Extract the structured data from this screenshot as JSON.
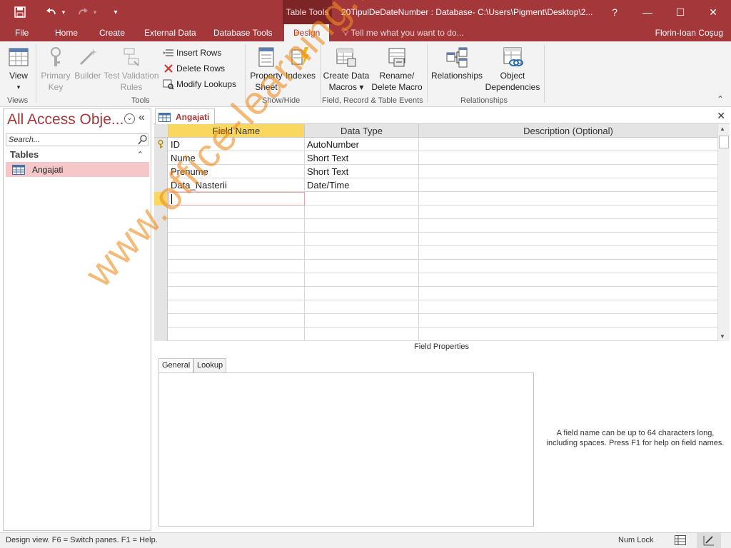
{
  "window": {
    "title": "20TipulDeDateNumber : Database- C:\\Users\\Pigment\\Desktop\\2...",
    "context_tab_group": "Table Tools",
    "help": "?",
    "minimize": "—",
    "maximize": "☐",
    "close": "✕"
  },
  "qat": {
    "save": "🖫",
    "undo": "↶",
    "undo_dd": "▾",
    "redo": "↷",
    "redo_dd": "▾",
    "customize": "▾"
  },
  "tabs": [
    {
      "label": "File"
    },
    {
      "label": "Home"
    },
    {
      "label": "Create"
    },
    {
      "label": "External Data"
    },
    {
      "label": "Database Tools"
    },
    {
      "label": "Design"
    }
  ],
  "tellme": "Tell me what you want to do...",
  "user": "Florin-Ioan Coşug",
  "ribbon": {
    "view": {
      "line1": "View",
      "line2": "▾",
      "group": "Views"
    },
    "primary_key": {
      "line1": "Primary",
      "line2": "Key"
    },
    "builder": {
      "line1": "Builder"
    },
    "test_validation": {
      "line1": "Test Validation",
      "line2": "Rules"
    },
    "insert_rows": "Insert Rows",
    "delete_rows": "Delete Rows",
    "modify_lookups": "Modify Lookups",
    "tools_group": "Tools",
    "property_sheet": {
      "line1": "Property",
      "line2": "Sheet"
    },
    "indexes": {
      "line1": "Indexes"
    },
    "showhide_group": "Show/Hide",
    "create_data_macros": {
      "line1": "Create Data",
      "line2": "Macros ▾"
    },
    "rename_delete_macro": {
      "line1": "Rename/",
      "line2": "Delete Macro"
    },
    "events_group": "Field, Record & Table Events",
    "relationships": {
      "line1": "Relationships"
    },
    "object_dependencies": {
      "line1": "Object",
      "line2": "Dependencies"
    },
    "relationships_group": "Relationships",
    "collapse": "⌃"
  },
  "nav": {
    "title": "All Access Obje...",
    "menu_icon": "⌄",
    "collapse_icon": "«",
    "search_placeholder": "Search...",
    "group": "Tables",
    "group_toggle": "⌃",
    "items": [
      {
        "label": "Angajati"
      }
    ]
  },
  "doc": {
    "tab": "Angajati",
    "close": "✕",
    "headers": [
      "Field Name",
      "Data Type",
      "Description (Optional)"
    ],
    "rows": [
      {
        "field": "ID",
        "type": "AutoNumber",
        "desc": "",
        "key": true
      },
      {
        "field": "Nume",
        "type": "Short Text",
        "desc": ""
      },
      {
        "field": "Prenume",
        "type": "Short Text",
        "desc": ""
      },
      {
        "field": "Data_Nasterii",
        "type": "Date/Time",
        "desc": ""
      }
    ],
    "field_properties": "Field Properties",
    "fp_tabs": [
      "General",
      "Lookup"
    ],
    "help_text": "A field name can be up to 64 characters long, including spaces. Press F1 for help on field names."
  },
  "status": {
    "text": "Design view.  F6 = Switch panes.  F1 = Help.",
    "numlock": "Num Lock"
  },
  "watermark": "www.office-learning.ro",
  "colors": {
    "accent": "#a4373a",
    "selection": "#fad75e",
    "nav_selected": "#f6c7c9"
  }
}
